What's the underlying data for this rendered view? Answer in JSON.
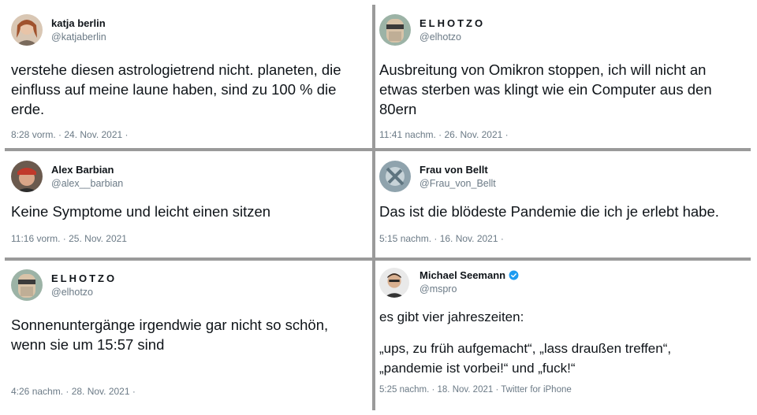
{
  "tweets": [
    {
      "name": "katja berlin",
      "handle": "@katjaberlin",
      "text": "verstehe diesen astrologietrend nicht. planeten, die einfluss auf meine laune haben, sind zu 100 % die erde.",
      "meta": "8:28 vorm. · 24. Nov. 2021 ·"
    },
    {
      "name": "ELHOTZO",
      "handle": "@elhotzo",
      "text": "Ausbreitung von Omikron stoppen, ich will nicht an etwas sterben was klingt wie ein Computer aus den 80ern",
      "meta": "11:41 nachm. · 26. Nov. 2021 ·"
    },
    {
      "name": "Alex Barbian",
      "handle": "@alex__barbian",
      "text": "Keine Symptome und leicht einen sitzen",
      "meta": "11:16 vorm. · 25. Nov. 2021"
    },
    {
      "name": "Frau von Bellt",
      "handle": "@Frau_von_Bellt",
      "text": "Das ist die blödeste Pandemie die ich je erlebt habe.",
      "meta": "5:15 nachm. · 16. Nov. 2021 ·"
    },
    {
      "name": "ELHOTZO",
      "handle": "@elhotzo",
      "text": "Sonnenuntergänge irgendwie gar nicht so schön, wenn sie um 15:57 sind",
      "meta": "4:26 nachm. · 28. Nov. 2021 ·"
    },
    {
      "name": "Michael Seemann",
      "handle": "@mspro",
      "text_line1": "es gibt vier jahreszeiten:",
      "text_line2": "„ups, zu früh aufgemacht“, „lass draußen treffen“, „pandemie ist vorbei!“ und „fuck!“",
      "meta": "5:25 nachm. · 18. Nov. 2021 · Twitter for iPhone",
      "verified": true
    }
  ],
  "colors": {
    "text": "#0f1419",
    "muted": "#6b7a86",
    "verified": "#1d9bf0",
    "separator": "#9a9a9a"
  },
  "icons": [
    "verified-badge-icon"
  ]
}
